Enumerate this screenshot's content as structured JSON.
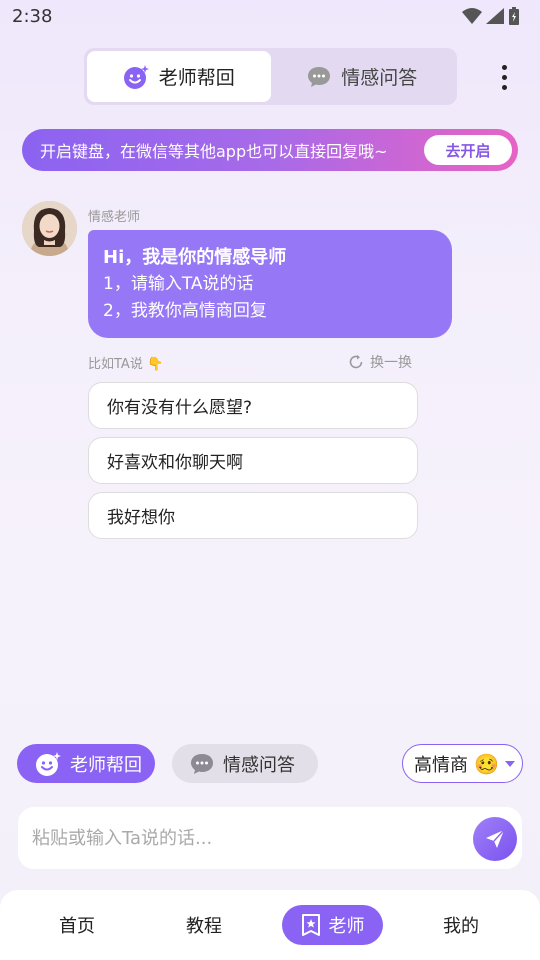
{
  "status_bar": {
    "time": "2:38"
  },
  "top_tabs": [
    {
      "label": "老师帮回",
      "icon": "smiley-sparkle-icon",
      "active": true
    },
    {
      "label": "情感问答",
      "icon": "chat-bubble-icon",
      "active": false
    }
  ],
  "banner": {
    "text": "开启键盘，在微信等其他app也可以直接回复哦~",
    "button_label": "去开启"
  },
  "chat": {
    "sender_name": "情感老师",
    "bubble": {
      "title": "Hi，我是你的情感导师",
      "line1": "1，请输入TA说的话",
      "line2": "2，我教你高情商回复"
    }
  },
  "suggestions": {
    "hint": "比如TA说 👇",
    "refresh_label": "换一换",
    "items": [
      "你有没有什么愿望?",
      "好喜欢和你聊天啊",
      "我好想你"
    ]
  },
  "mode_buttons": {
    "teacher_label": "老师帮回",
    "qa_label": "情感问答"
  },
  "eq_select": {
    "label": "高情商",
    "emoji": "🥴"
  },
  "input": {
    "placeholder": "粘贴或输入Ta说的话..."
  },
  "bottom_nav": [
    {
      "label": "首页",
      "active": false
    },
    {
      "label": "教程",
      "active": false
    },
    {
      "label": "老师",
      "active": true,
      "icon": "teacher-badge-icon"
    },
    {
      "label": "我的",
      "active": false
    }
  ],
  "colors": {
    "accent": "#8a63f4",
    "bubble": "#9678f6",
    "banner_start": "#8b63f1",
    "banner_end": "#e763c5"
  }
}
